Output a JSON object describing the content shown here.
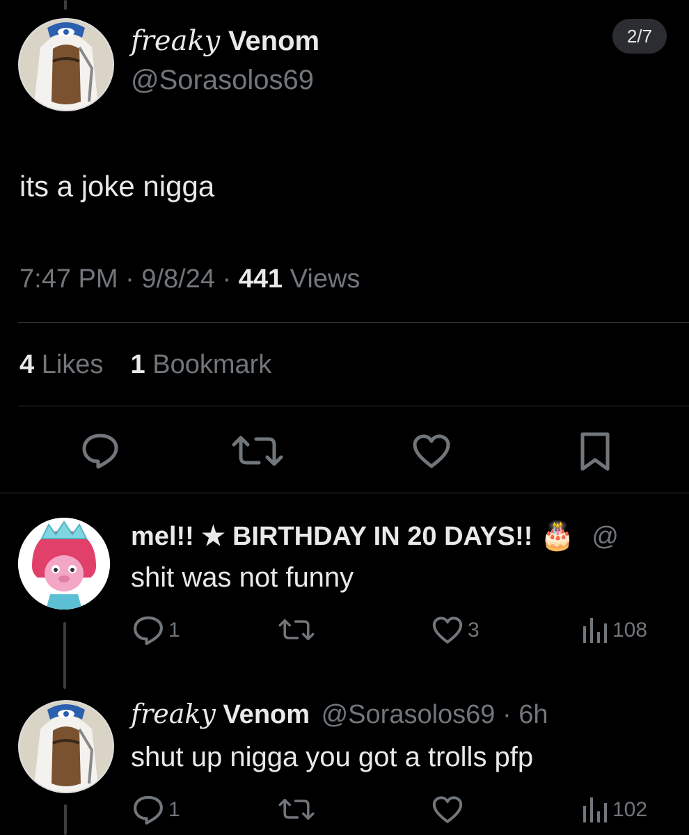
{
  "main_tweet": {
    "author_fancy": "freaky",
    "author_name": "Venom",
    "handle": "@Sorasolos69",
    "page_indicator": "2/7",
    "text": "its a joke nigga",
    "time": "7:47 PM",
    "date": "9/8/24",
    "views_count": "441",
    "views_label": "Views",
    "likes_count": "4",
    "likes_label": "Likes",
    "bookmarks_count": "1",
    "bookmarks_label": "Bookmark",
    "icons": [
      "reply-icon",
      "retweet-icon",
      "heart-icon",
      "bookmark-icon"
    ]
  },
  "replies": [
    {
      "author_name": "mel!! ★ BIRTHDAY IN 20 DAYS!!",
      "emoji": "🎂",
      "handle_partial": "@",
      "text": "shit was not funny",
      "reply_count": "1",
      "like_count": "3",
      "views_count": "108"
    },
    {
      "author_fancy": "freaky",
      "author_name": "Venom",
      "handle_time": "@Sorasolos69 · 6h",
      "text": "shut up nigga you got a trolls pfp",
      "reply_count": "1",
      "views_count": "102"
    }
  ],
  "colors": {
    "background": "#000000",
    "text": "#e7e9ea",
    "muted": "#71767b",
    "divider": "#2f3336"
  }
}
